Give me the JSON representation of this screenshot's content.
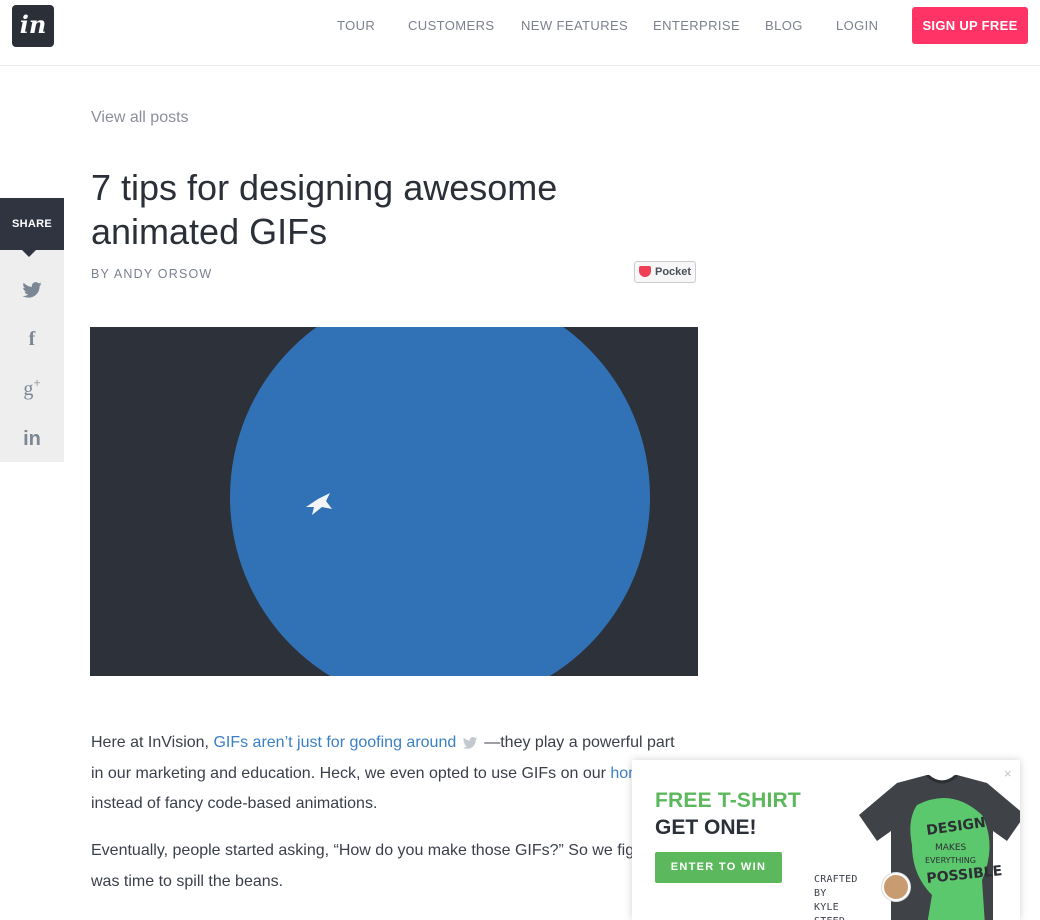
{
  "header": {
    "logo_text": "in",
    "nav": [
      "TOUR",
      "CUSTOMERS",
      "NEW FEATURES",
      "ENTERPRISE",
      "BLOG",
      "LOGIN"
    ],
    "signup_label": "SIGN UP FREE",
    "accent_color": "#ff3366"
  },
  "share": {
    "label": "SHARE",
    "icons": [
      "twitter-icon",
      "facebook-icon",
      "google-plus-icon",
      "linkedin-icon"
    ]
  },
  "article": {
    "view_all": "View all posts",
    "title": "7 tips for designing awesome animated GIFs",
    "byline": "BY ANDY ORSOW",
    "pocket_label": "Pocket",
    "p1": {
      "before": "Here at InVision, ",
      "link1": "GIFs aren’t just for goofing around",
      "middle": "—they play a powerful part in our marketing and education. Heck, we even opted to use GIFs on our ",
      "link2": "home page",
      "after": " instead of fancy code-based animations."
    },
    "p2": "Eventually, people started asking, “How do you make those GIFs?” So we figured it was time to spill the beans."
  },
  "popup": {
    "title": "FREE T-SHIRT",
    "subtitle": "GET ONE!",
    "button": "ENTER TO WIN",
    "close": "×",
    "crafted_line1": "CRAFTED BY",
    "crafted_line2": "KYLE STEED",
    "shirt_text": [
      "DESIGN",
      "MAKES",
      "EVERYTHING",
      "POSSIBLE"
    ]
  }
}
